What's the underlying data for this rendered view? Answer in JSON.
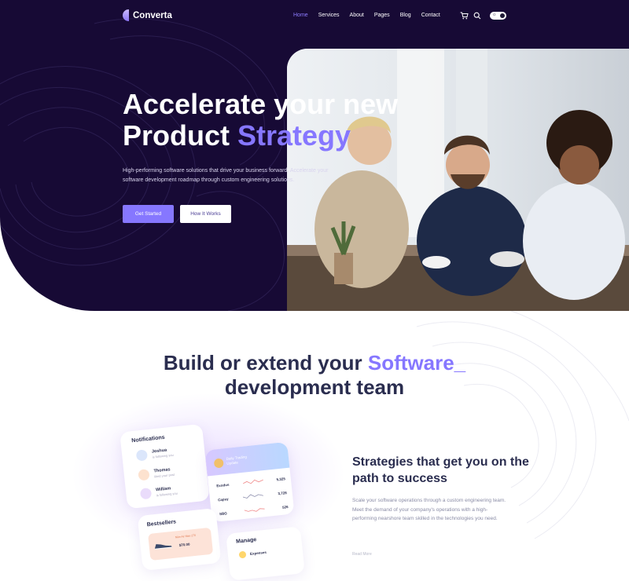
{
  "brand": {
    "name": "Converta"
  },
  "nav": {
    "items": [
      "Home",
      "Services",
      "About",
      "Pages",
      "Blog",
      "Contact"
    ],
    "active": "Home",
    "icons": [
      "cart-icon",
      "search-icon",
      "theme-toggle"
    ]
  },
  "hero": {
    "title_line1": "Accelerate your new",
    "title_line2_prefix": "Product ",
    "title_line2_accent": "Strategy",
    "description": "High-performing software solutions that drive your business forward. Accelerate your software development roadmap through custom engineering solutions.",
    "primary_button": "Get Started",
    "secondary_button": "How It Works"
  },
  "section": {
    "title_prefix": "Build or extend your ",
    "title_accent": "Software_",
    "title_line2": "development team"
  },
  "cards": {
    "notifications": {
      "title": "Notifications",
      "items": [
        {
          "name": "Joshua",
          "sub": "is following you"
        },
        {
          "name": "Thomas",
          "sub": "liked your post"
        },
        {
          "name": "William",
          "sub": "is following you"
        }
      ]
    },
    "trading": {
      "header": "Daily Trading Update",
      "rows": [
        {
          "name": "Exodus",
          "value": "5,325"
        },
        {
          "name": "Capsy",
          "value": "3,728"
        },
        {
          "name": "SBG",
          "value": "526"
        }
      ]
    },
    "bestsellers": {
      "title": "Bestsellers",
      "item_label": "Nike Air Max 270",
      "item_price": "$70.00"
    },
    "manage": {
      "title": "Manage",
      "item": "Expenses"
    }
  },
  "strategies": {
    "title": "Strategies that get you on the path to success",
    "description": "Scale your software operations through a custom engineering team. Meet the demand of your company's operations with a high-performing nearshore team skilled in the technologies you need.",
    "more": "Read More"
  },
  "colors": {
    "hero_bg": "#170a35",
    "accent": "#8677ff",
    "heading": "#2a2d4f"
  }
}
